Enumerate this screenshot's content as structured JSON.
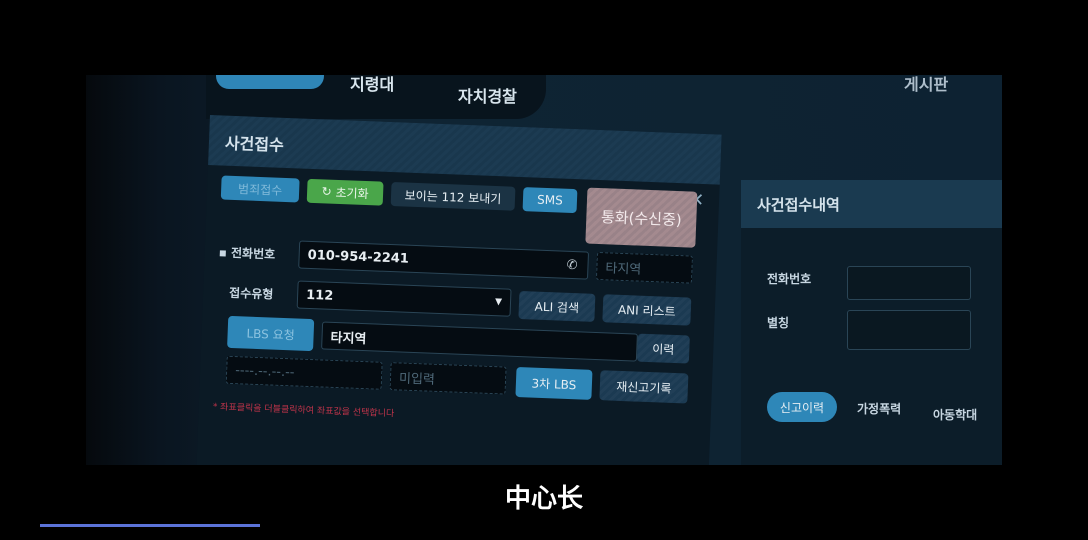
{
  "tabs": [
    {
      "label": "지령대",
      "active": false
    },
    {
      "label": "자치경찰"
    },
    {
      "label": "게시판"
    }
  ],
  "panel": {
    "title": "사건접수",
    "buttons": {
      "crime": "범죄접수",
      "reset": "초기화",
      "visible112": "보이는 112 보내기",
      "sms": "SMS",
      "call": "통화(수신중)",
      "ali": "ALI 검색",
      "ani": "ANI 리스트",
      "lbs": "LBS 요청",
      "history": "이력",
      "lbs3": "3차 LBS",
      "rereport": "재신고기록"
    },
    "phone_label": "전화번호",
    "phone_value": "010-954-2241",
    "type_label": "접수유형",
    "type_value": "112",
    "region_placeholder": "타지역",
    "location_value": "타지역",
    "coords_placeholder": "----.--.--.--",
    "uninput_placeholder": "미입력",
    "note": "* 좌표클릭을 더블클릭하여 좌표값을 선택합니다"
  },
  "right": {
    "title": "사건접수내역",
    "phone_label": "전화번호",
    "alias_label": "별칭",
    "tabs": [
      "신고이력",
      "가정폭력",
      "아동학대"
    ]
  },
  "subtitle": "中心长",
  "colors": {
    "accent": "#2e87b8",
    "reset": "#4aa64a",
    "call": "#a48a8f",
    "progress": "#5b73d8"
  },
  "video_progress": 0.2
}
